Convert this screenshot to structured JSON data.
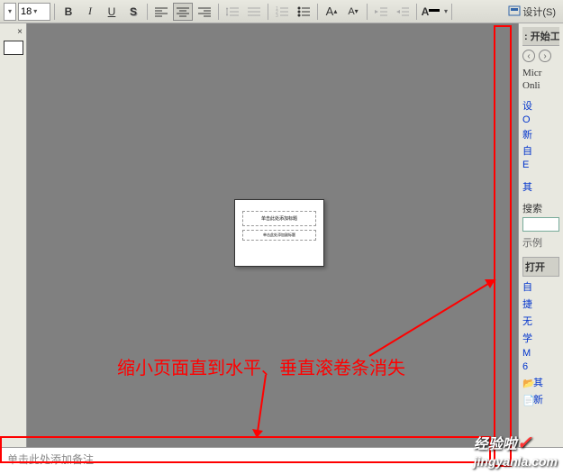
{
  "toolbar": {
    "font_size": "18",
    "bold": "B",
    "italic": "I",
    "underline": "U",
    "shadow": "S",
    "design_label": "设计(S)"
  },
  "panels": {
    "right_header": "开始工",
    "microsoft": "Micr",
    "online": "Onli",
    "link1": "设",
    "link2": "O",
    "link3": "新",
    "link4": "自",
    "link5": "E",
    "link6": "其",
    "search_label": "搜索",
    "example_label": "示例",
    "open_section": "打开",
    "item1": "自",
    "item2": "捷",
    "item3": "无",
    "item4": "学",
    "item5": "M",
    "item6": "6",
    "item7": "其",
    "item8": "新"
  },
  "slide": {
    "title_placeholder": "单击此处添加标题",
    "subtitle_placeholder": "单击此处添加副标题"
  },
  "notes": {
    "placeholder": "单击此处添加备注"
  },
  "annotation": {
    "text": "缩小页面直到水平、垂直滚卷条消失"
  },
  "watermark": {
    "brand": "经验啦",
    "url": "jingyanla.com"
  }
}
